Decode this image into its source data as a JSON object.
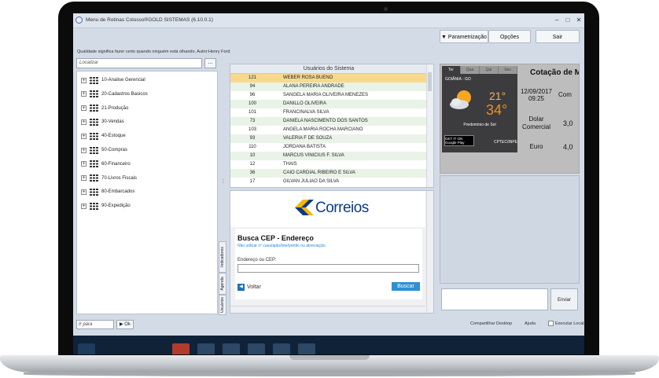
{
  "window": {
    "title": "Menu de Rotinas  Colosso®GOLD SISTEMAS (6.10.0.1)",
    "minimize": "–",
    "maximize": "□",
    "close": "✕"
  },
  "toolbar": {
    "param_label": "▼ Parametrização",
    "options_label": "Opções",
    "exit_label": "Sair"
  },
  "quote": "Qualidade significa fazer certo quando ninguém está olhando. Autor:Henry Ford",
  "search": {
    "placeholder": "Localizar",
    "button": "..."
  },
  "tree": {
    "items": [
      "10-Analise Gerencial",
      "20-Cadastros Basicos",
      "21-Produção",
      "30-Vendas",
      "40-Estoque",
      "50-Compras",
      "60-Financeiro",
      "70-Livros Fiscais",
      "80-Embarcados",
      "90-Expedição"
    ]
  },
  "side_tabs": [
    "Indicadores",
    "Agenda",
    "Usuários"
  ],
  "users": {
    "header": "Usuários do Sistema",
    "rows": [
      {
        "code": "121",
        "name": "WEBER ROSA BUENO"
      },
      {
        "code": "94",
        "name": "ALANA PEREIRA ANDRADE"
      },
      {
        "code": "96",
        "name": "SANGELA MARIA OLIVEIRA MENEZES"
      },
      {
        "code": "100",
        "name": "DANILLO OLIVEIRA"
      },
      {
        "code": "101",
        "name": "FRANCINALVA SILVA"
      },
      {
        "code": "73",
        "name": "DANIELA NASCIMENTO DOS SANTOS"
      },
      {
        "code": "103",
        "name": "ANGELA MARIA ROCHA MARCIANO"
      },
      {
        "code": "93",
        "name": "VALERIA F DE SOUZA"
      },
      {
        "code": "110",
        "name": "JORDANA BATISTA"
      },
      {
        "code": "10",
        "name": "MARCUS VINICIUS F. SILVA"
      },
      {
        "code": "12",
        "name": "THAIS"
      },
      {
        "code": "36",
        "name": "CAIO CARDIAL RIBEIRO E SILVA"
      },
      {
        "code": "17",
        "name": "GILVAN JULIAO DA SILVA"
      }
    ]
  },
  "cep": {
    "logo_text": "Correios",
    "title": "Busca CEP - Endereço",
    "subtitle": "Não utilizar nº casa/apto/lote/prédio ou abreviação.",
    "field_label": "Endereço ou CEP:",
    "field_value": "",
    "back_label": "Voltar",
    "search_label": "Buscar"
  },
  "weather": {
    "tabs": [
      "Ter",
      "Qua",
      "Qui",
      "Sex"
    ],
    "city": "GOIÂNIA - GO",
    "temp_min": "21°",
    "temp_max": "34°",
    "description": "Predomínio de Sol",
    "play_label": "GET IT ON Google Play",
    "source": "CPTEC/INPE"
  },
  "cotacao": {
    "title": "Cotação de M",
    "date": "12/09/2017 09:25",
    "col_label": "Com",
    "dolar_label": "Dolar Comercial",
    "dolar_value": "3,0",
    "euro_label": "Euro",
    "euro_value": "4,0"
  },
  "chat": {
    "send_label": "Enviar"
  },
  "footer": {
    "goto_placeholder": "Ir para",
    "ok_label": "▶ Ok",
    "share_label": "Compartilhar Desktop",
    "help_label": "Ajuda",
    "local_label": "Executar Local"
  },
  "colors": {
    "selected_row": "#f7d98c",
    "alt_row": "#e9f3e7",
    "correios_blue": "#0a3b82",
    "correios_yellow": "#f5b800"
  }
}
